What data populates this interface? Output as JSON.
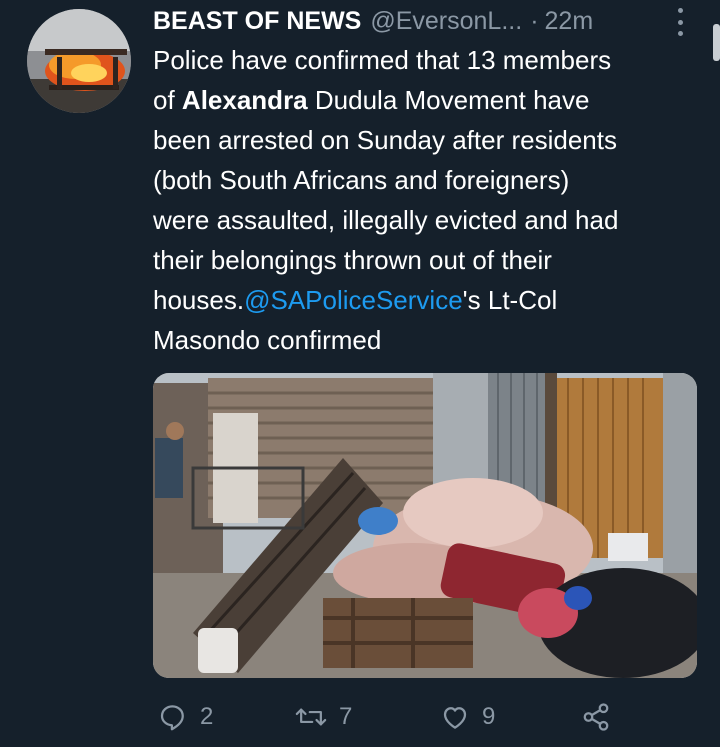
{
  "tweet": {
    "author_name": "BEAST OF NEWS",
    "author_handle": "@EversonL...",
    "separator": "·",
    "time": "22m",
    "text": {
      "line1": "Police have confirmed that 13 members",
      "line2_prefix": "of ",
      "line2_bold": "Alexandra",
      "line2_suffix": " Dudula Movement have",
      "line3": "been arrested on Sunday after residents",
      "line4": "(both South Africans and foreigners)",
      "line5": "were assaulted, illegally evicted and had",
      "line6": "their belongings thrown out of their",
      "line7_prefix": "houses.",
      "line7_mention": "@SAPoliceService",
      "line7_suffix": "'s Lt-Col",
      "line8": "Masondo confirmed"
    }
  },
  "actions": {
    "reply_count": "2",
    "retweet_count": "7",
    "like_count": "9"
  },
  "icons": {
    "reply": "reply-icon",
    "retweet": "retweet-icon",
    "like": "heart-icon",
    "share": "share-icon",
    "more": "more-icon"
  },
  "colors": {
    "background": "#15202b",
    "text": "#ffffff",
    "secondary": "#8b98a5",
    "link": "#1d9bf0"
  }
}
